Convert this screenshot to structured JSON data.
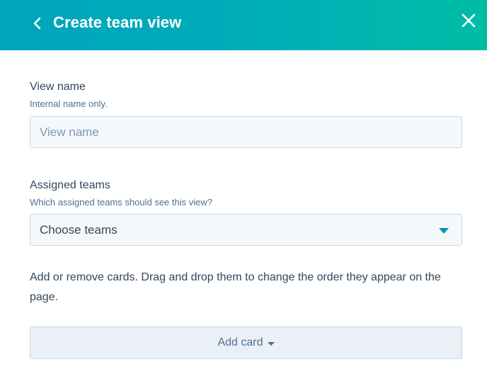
{
  "header": {
    "title": "Create team view",
    "back_icon": "chevron-left-icon",
    "close_icon": "close-icon",
    "gradient_start": "#00a4bd",
    "gradient_end": "#00bda5"
  },
  "view_name": {
    "label": "View name",
    "help": "Internal name only.",
    "value": "",
    "placeholder": "View name"
  },
  "assigned_teams": {
    "label": "Assigned teams",
    "help": "Which assigned teams should see this view?",
    "selected": "Choose teams",
    "caret_icon": "caret-down-icon",
    "caret_color": "#0091ae"
  },
  "cards": {
    "instructions": "Add or remove cards. Drag and drop them to change the order they appear on the page.",
    "add_button_label": "Add card",
    "add_button_icon": "caret-down-icon"
  }
}
